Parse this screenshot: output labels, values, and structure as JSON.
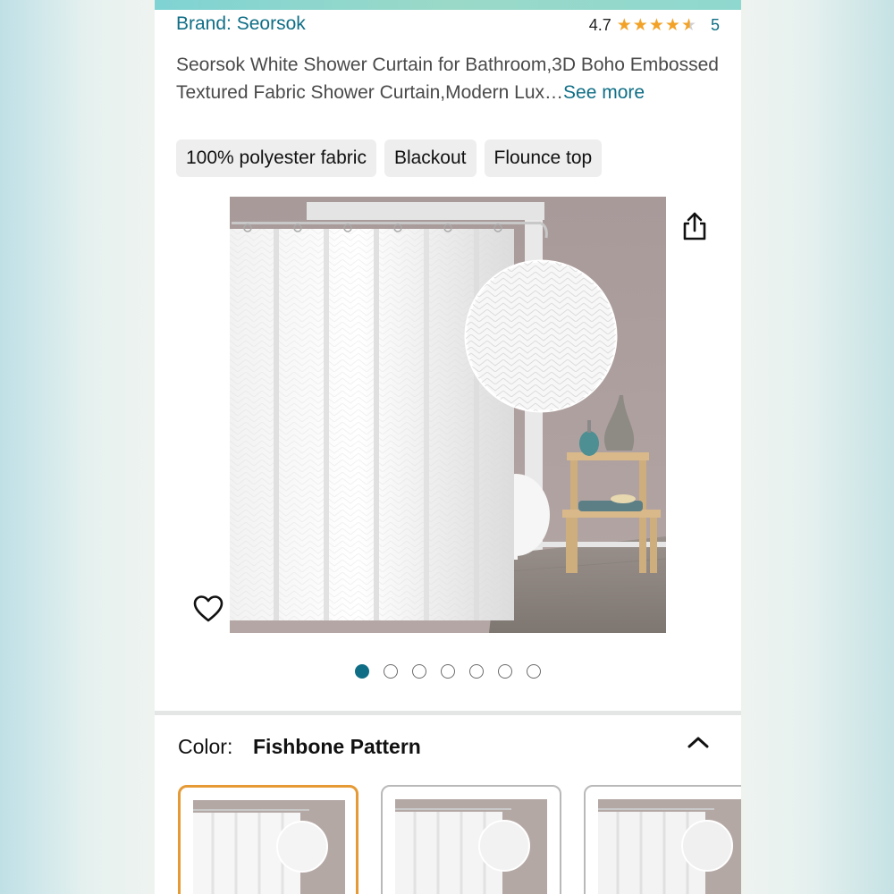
{
  "product": {
    "brand": "Brand: Seorsok",
    "rating_value": "4.7",
    "rating_count": "5",
    "rating_stars": 4.7,
    "title": "Seorsok White Shower Curtain for Bathroom,3D Boho Embossed Textured Fabric Shower Curtain,Modern Lux…",
    "see_more": "See more"
  },
  "chips": [
    "100% polyester fabric",
    "Blackout",
    "Flounce top"
  ],
  "gallery": {
    "image_count": 7,
    "active_index": 0,
    "icons": {
      "share": "share-icon",
      "favorite": "heart-icon"
    }
  },
  "variation": {
    "label": "Color:",
    "value": "Fishbone Pattern",
    "collapse_icon": "chevron-up-icon",
    "swatch_count": 3,
    "selected_index": 0
  },
  "colors": {
    "brand_link": "#0f6e86",
    "star": "#f2a227",
    "selected_border": "#e59a35",
    "chip_bg": "#eeeeee"
  }
}
